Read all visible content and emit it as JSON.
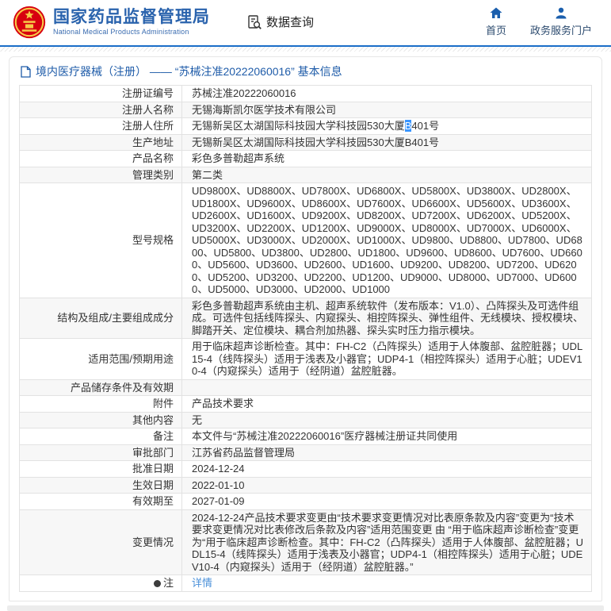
{
  "header": {
    "org_name_cn": "国家药品监督管理局",
    "org_name_en": "National Medical Products Administration",
    "data_query_label": "数据查询",
    "nav": [
      {
        "label": "首页",
        "icon": "home-icon"
      },
      {
        "label": "政务服务门户",
        "icon": "user-icon"
      }
    ]
  },
  "breadcrumb": {
    "text": "境内医疗器械（注册） —— “苏械注准20222060016” 基本信息",
    "icon": "document-icon"
  },
  "table": {
    "rows": [
      {
        "label": "注册证编号",
        "segments": [
          {
            "type": "text",
            "text": "苏械注准20222060016"
          }
        ]
      },
      {
        "label": "注册人名称",
        "segments": [
          {
            "type": "text",
            "text": "无锡海斯凯尔医学技术有限公司"
          }
        ]
      },
      {
        "label": "注册人住所",
        "segments": [
          {
            "type": "text",
            "text": "无锡新吴区太湖国际科技园大学科技园530大厦"
          },
          {
            "type": "highlight",
            "text": "B"
          },
          {
            "type": "text",
            "text": "401号"
          }
        ]
      },
      {
        "label": "生产地址",
        "segments": [
          {
            "type": "text",
            "text": "无锡新吴区太湖国际科技园大学科技园530大厦B401号"
          }
        ]
      },
      {
        "label": "产品名称",
        "segments": [
          {
            "type": "text",
            "text": "彩色多普勒超声系统"
          }
        ]
      },
      {
        "label": "管理类别",
        "segments": [
          {
            "type": "text",
            "text": "第二类"
          }
        ]
      },
      {
        "label": "型号规格",
        "segments": [
          {
            "type": "text",
            "text": "UD9800X、UD8800X、UD7800X、UD6800X、UD5800X、UD3800X、UD2800X、UD1800X、UD9600X、UD8600X、UD7600X、UD6600X、UD5600X、UD3600X、UD2600X、UD1600X、UD9200X、UD8200X、UD7200X、UD6200X、UD5200X、UD3200X、UD2200X、UD1200X、UD9000X、UD8000X、UD7000X、UD6000X、UD5000X、UD3000X、UD2000X、UD1000X、UD9800、UD8800、UD7800、UD6800、UD5800、UD3800、UD2800、UD1800、UD9600、UD8600、UD7600、UD6600、UD5600、UD3600、UD2600、UD1600、UD9200、UD8200、UD7200、UD6200、UD5200、UD3200、UD2200、UD1200、UD9000、UD8000、UD7000、UD6000、UD5000、UD3000、UD2000、UD1000"
          }
        ]
      },
      {
        "label": "结构及组成/主要组成成分",
        "segments": [
          {
            "type": "text",
            "text": "彩色多普勒超声系统由主机、超声系统软件（发布版本：V1.0）、凸阵探头及可选件组成。可选件包括线阵探头、内窥探头、相控阵探头、弹性组件、无线模块、授权模块、脚踏开关、定位模块、耦合剂加热器、探头实时压力指示模块。"
          }
        ]
      },
      {
        "label": "适用范围/预期用途",
        "segments": [
          {
            "type": "text",
            "text": "用于临床超声诊断检查。其中：FH-C2（凸阵探头）适用于人体腹部、盆腔脏器；UDL15-4（线阵探头）适用于浅表及小器官；UDP4-1（相控阵探头）适用于心脏；UDEV10-4（内窥探头）适用于（经阴道）盆腔脏器。"
          }
        ]
      },
      {
        "label": "产品储存条件及有效期",
        "segments": []
      },
      {
        "label": "附件",
        "segments": [
          {
            "type": "text",
            "text": "产品技术要求"
          }
        ]
      },
      {
        "label": "其他内容",
        "segments": [
          {
            "type": "text",
            "text": "无"
          }
        ]
      },
      {
        "label": "备注",
        "segments": [
          {
            "type": "text",
            "text": "本文件与“苏械注准20222060016”医疗器械注册证共同使用"
          }
        ]
      },
      {
        "label": "审批部门",
        "segments": [
          {
            "type": "text",
            "text": "江苏省药品监督管理局"
          }
        ]
      },
      {
        "label": "批准日期",
        "segments": [
          {
            "type": "text",
            "text": "2024-12-24"
          }
        ]
      },
      {
        "label": "生效日期",
        "segments": [
          {
            "type": "text",
            "text": "2022-01-10"
          }
        ]
      },
      {
        "label": "有效期至",
        "segments": [
          {
            "type": "text",
            "text": "2027-01-09"
          }
        ]
      },
      {
        "label": "变更情况",
        "segments": [
          {
            "type": "text",
            "text": "2024-12-24产品技术要求变更由“技术要求变更情况对比表原条款及内容”变更为“技术要求变更情况对比表修改后条款及内容”适用范围变更 由 “用于临床超声诊断检查”变更为“用于临床超声诊断检查。其中：FH-C2（凸阵探头）适用于人体腹部、盆腔脏器；UDL15-4（线阵探头）适用于浅表及小器官；UDP4-1（相控阵探头）适用于心脏；UDEV10-4（内窥探头）适用于（经阴道）盆腔脏器。”"
          }
        ]
      },
      {
        "label": "注",
        "label_icon": "note-icon",
        "segments": [
          {
            "type": "link",
            "text": "详情"
          }
        ]
      }
    ]
  },
  "colors": {
    "brand_blue": "#2a63ad",
    "divider_blue": "#1b6ec8",
    "breadcrumb_blue": "#1f5ca9",
    "link_blue": "#4a90d9",
    "selection_blue": "#3895ff",
    "emblem_red": "#d7000f",
    "emblem_gold": "#f7c948",
    "nav_icon_blue": "#1b5fad",
    "stripe_gray": "#f7f7f7",
    "border_gray": "#e2e2e2"
  }
}
